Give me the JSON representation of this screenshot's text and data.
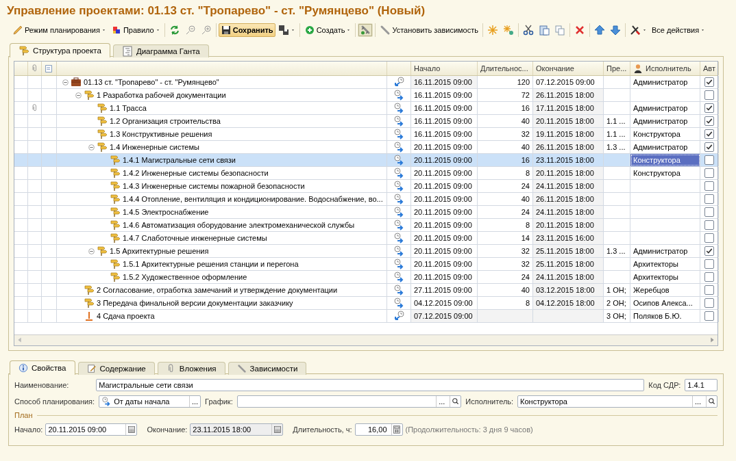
{
  "window": {
    "title": "Управление проектами: 01.13 ст. \"Тропарево\" - ст. \"Румянцево\" (Новый)"
  },
  "toolbar": {
    "groups": [
      [
        {
          "label": "Режим планирования",
          "dropdown": true,
          "pressed": false,
          "default": false
        },
        {
          "label": "Правило",
          "dropdown": true,
          "pressed": false,
          "default": false
        }
      ],
      [
        {
          "dropdown": false,
          "pressed": false,
          "default": false
        },
        {
          "dropdown": false,
          "pressed": false,
          "default": false
        },
        {
          "dropdown": false,
          "pressed": false,
          "default": false
        }
      ],
      [
        {
          "label": "Сохранить",
          "dropdown": false,
          "pressed": false,
          "default": true
        },
        {
          "dropdown": true,
          "pressed": false,
          "default": false
        }
      ],
      [
        {
          "label": "Создать",
          "dropdown": true,
          "pressed": false,
          "default": false
        }
      ],
      [
        {
          "dropdown": false,
          "pressed": true,
          "default": false
        }
      ],
      [
        {
          "label": "Установить зависимость",
          "dropdown": false,
          "pressed": false,
          "default": false
        }
      ],
      [
        {
          "dropdown": false,
          "pressed": false,
          "default": false
        },
        {
          "dropdown": false,
          "pressed": false,
          "default": false
        }
      ],
      [
        {
          "dropdown": false,
          "pressed": false,
          "default": false
        },
        {
          "dropdown": false,
          "pressed": false,
          "default": false
        },
        {
          "dropdown": false,
          "pressed": false,
          "default": false
        }
      ],
      [
        {
          "dropdown": false,
          "pressed": false,
          "default": false
        }
      ],
      [
        {
          "dropdown": false,
          "pressed": false,
          "default": false
        },
        {
          "dropdown": false,
          "pressed": false,
          "default": false
        }
      ],
      [
        {
          "dropdown": true,
          "pressed": false,
          "default": false
        },
        {
          "label": "Все действия",
          "dropdown": true,
          "pressed": false,
          "default": false
        }
      ]
    ]
  },
  "tabs": [
    {
      "label": "Структура проекта",
      "selected": true
    },
    {
      "label": "Диаграмма Ганта",
      "selected": false
    }
  ],
  "table": {
    "columns": [
      {
        "label": "Начало"
      },
      {
        "label": "Длительнос..."
      },
      {
        "label": "Окончание"
      },
      {
        "label": "Пре..."
      },
      {
        "label": "Исполнитель"
      },
      {
        "label": "Авт"
      }
    ],
    "rows": [
      {
        "kind": "project",
        "name": "01.13 ст. \"Тропарево\" - ст. \"Румянцево\"",
        "backward": true,
        "start": "16.11.2015 09:00",
        "duration": "120",
        "end": "07.12.2015 09:00",
        "executor": "Администратор",
        "auto": true,
        "attachment": false,
        "selected": false,
        "expanded": true,
        "children": [
          {
            "kind": "task",
            "name": "1 Разработка рабочей документации",
            "backward": false,
            "start": "16.11.2015 09:00",
            "duration": "72",
            "end": "26.11.2015 18:00",
            "auto": false,
            "attachment": false,
            "selected": false,
            "expanded": true,
            "children": [
              {
                "kind": "task",
                "name": "1.1 Трасса",
                "backward": false,
                "start": "16.11.2015 09:00",
                "duration": "16",
                "end": "17.11.2015 18:00",
                "executor": "Администратор",
                "auto": true,
                "attachment": true,
                "selected": false
              },
              {
                "kind": "task",
                "name": "1.2 Организация строительства",
                "backward": false,
                "start": "16.11.2015 09:00",
                "duration": "40",
                "end": "20.11.2015 18:00",
                "predecessors": "1.1 ...",
                "executor": "Администратор",
                "auto": true,
                "attachment": false,
                "selected": false
              },
              {
                "kind": "task",
                "name": "1.3 Конструктивные решения",
                "backward": false,
                "start": "16.11.2015 09:00",
                "duration": "32",
                "end": "19.11.2015 18:00",
                "predecessors": "1.1 ...",
                "executor": "Конструктора",
                "auto": true,
                "attachment": false,
                "selected": false
              },
              {
                "kind": "task",
                "name": "1.4 Инженерные системы",
                "backward": false,
                "start": "20.11.2015 09:00",
                "duration": "40",
                "end": "26.11.2015 18:00",
                "predecessors": "1.3 ...",
                "executor": "Администратор",
                "auto": true,
                "attachment": false,
                "selected": false,
                "expanded": true,
                "children": [
                  {
                    "kind": "task",
                    "name": "1.4.1 Магистральные сети связи",
                    "backward": false,
                    "start": "20.11.2015 09:00",
                    "duration": "16",
                    "end": "23.11.2015 18:00",
                    "executor": "Конструктора",
                    "auto": false,
                    "attachment": false,
                    "selected": true
                  },
                  {
                    "kind": "task",
                    "name": "1.4.2 Инженерные системы безопасности",
                    "backward": false,
                    "start": "20.11.2015 09:00",
                    "duration": "8",
                    "end": "20.11.2015 18:00",
                    "executor": "Конструктора",
                    "auto": false,
                    "attachment": false,
                    "selected": false
                  },
                  {
                    "kind": "task",
                    "name": "1.4.3 Инженерные системы пожарной безопасности",
                    "backward": false,
                    "start": "20.11.2015 09:00",
                    "duration": "24",
                    "end": "24.11.2015 18:00",
                    "auto": false,
                    "attachment": false,
                    "selected": false
                  },
                  {
                    "kind": "task",
                    "name": "1.4.4 Отопление, вентиляция и кондиционирование. Водоснабжение, во...",
                    "backward": false,
                    "start": "20.11.2015 09:00",
                    "duration": "40",
                    "end": "26.11.2015 18:00",
                    "auto": false,
                    "attachment": false,
                    "selected": false
                  },
                  {
                    "kind": "task",
                    "name": "1.4.5 Электроснабжение",
                    "backward": false,
                    "start": "20.11.2015 09:00",
                    "duration": "24",
                    "end": "24.11.2015 18:00",
                    "auto": false,
                    "attachment": false,
                    "selected": false
                  },
                  {
                    "kind": "task",
                    "name": "1.4.6 Автоматизация оборудование электромеханической службы",
                    "backward": false,
                    "start": "20.11.2015 09:00",
                    "duration": "8",
                    "end": "20.11.2015 18:00",
                    "auto": false,
                    "attachment": false,
                    "selected": false
                  },
                  {
                    "kind": "task",
                    "name": "1.4.7 Слаботочные инженерные системы",
                    "backward": false,
                    "start": "20.11.2015 09:00",
                    "duration": "14",
                    "end": "23.11.2015 16:00",
                    "auto": false,
                    "attachment": false,
                    "selected": false
                  }
                ]
              },
              {
                "kind": "task",
                "name": "1.5 Архитектурные решения",
                "backward": false,
                "start": "20.11.2015 09:00",
                "duration": "32",
                "end": "25.11.2015 18:00",
                "predecessors": "1.3 ...",
                "executor": "Администратор",
                "auto": true,
                "attachment": false,
                "selected": false,
                "expanded": true,
                "children": [
                  {
                    "kind": "task",
                    "name": "1.5.1 Архитектурные решения станции и перегона",
                    "backward": false,
                    "start": "20.11.2015 09:00",
                    "duration": "32",
                    "end": "25.11.2015 18:00",
                    "executor": "Архитекторы",
                    "auto": false,
                    "attachment": false,
                    "selected": false
                  },
                  {
                    "kind": "task",
                    "name": "1.5.2 Художественное оформление",
                    "backward": false,
                    "start": "20.11.2015 09:00",
                    "duration": "24",
                    "end": "24.11.2015 18:00",
                    "executor": "Архитекторы",
                    "auto": false,
                    "attachment": false,
                    "selected": false
                  }
                ]
              }
            ]
          },
          {
            "kind": "task",
            "name": "2 Согласование, отработка замечаний и утверждение документации",
            "backward": false,
            "start": "27.11.2015 09:00",
            "duration": "40",
            "end": "03.12.2015 18:00",
            "predecessors": "1 ОН;",
            "executor": "Жеребцов",
            "auto": false,
            "attachment": false,
            "selected": false
          },
          {
            "kind": "task",
            "name": "3 Передача финальной версии документации заказчику",
            "backward": false,
            "start": "04.12.2015 09:00",
            "duration": "8",
            "end": "04.12.2015 18:00",
            "predecessors": "2 ОН;",
            "executor": "Осипов Алекса...",
            "auto": false,
            "attachment": false,
            "selected": false
          },
          {
            "kind": "milestone",
            "name": "4 Сдача проекта",
            "backward": true,
            "start": "07.12.2015 09:00",
            "predecessors": "3 ОН;",
            "executor": "Поляков Б.Ю.",
            "auto": false,
            "attachment": false,
            "selected": false
          }
        ]
      }
    ]
  },
  "details": {
    "tabs": [
      {
        "label": "Свойства",
        "selected": true
      },
      {
        "label": "Содержание",
        "selected": false
      },
      {
        "label": "Вложения",
        "selected": false
      },
      {
        "label": "Зависимости",
        "selected": false
      }
    ],
    "name": {
      "label": "Наименование:",
      "value": "Магистральные сети связи"
    },
    "wbs": {
      "label": "Код СДР:",
      "value": "1.4.1"
    },
    "method": {
      "label": "Способ планирования:",
      "value": "От даты начала",
      "button": "..."
    },
    "schedule": {
      "label": "График:",
      "button": "..."
    },
    "executor": {
      "label": "Исполнитель:",
      "value": "Конструктора",
      "button": "..."
    },
    "plan": "План",
    "start": {
      "label": "Начало:",
      "value": "20.11.2015 09:00",
      "disabled": false
    },
    "end": {
      "label": "Окончание:",
      "value": "23.11.2015 18:00",
      "disabled": true
    },
    "duration": {
      "label": "Длительность, ч:",
      "value": "16,00"
    },
    "note": "(Продолжительность: 3 дня 9 часов)"
  }
}
